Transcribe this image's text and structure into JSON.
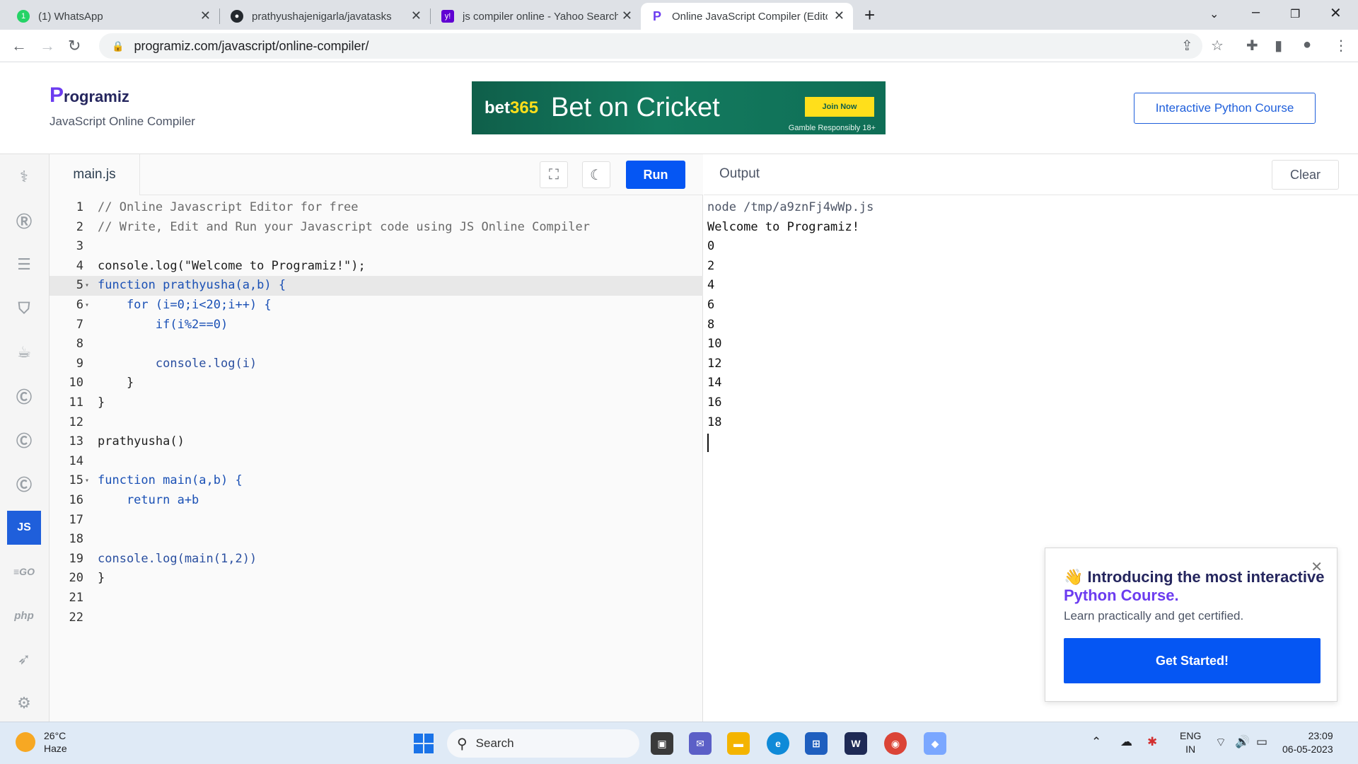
{
  "browser": {
    "tabs": [
      {
        "title": "(1) WhatsApp",
        "icon": "whatsapp-icon",
        "color": "#25d366"
      },
      {
        "title": "prathyushajenigarla/javatasks",
        "icon": "github-icon",
        "color": "#24292e"
      },
      {
        "title": "js compiler online - Yahoo Search",
        "icon": "yahoo-icon",
        "color": "#6001d2"
      },
      {
        "title": "Online JavaScript Compiler (Edito",
        "icon": "programiz-icon",
        "color": "#6c3cf0",
        "active": true
      }
    ],
    "new_tab": "+",
    "url": "programiz.com/javascript/online-compiler/"
  },
  "site": {
    "logo": "rogramiz",
    "logo_initial": "P",
    "subtitle": "JavaScript Online Compiler",
    "ad": {
      "brand_a": "bet",
      "brand_b": "365",
      "headline": "Bet on Cricket",
      "cta": "Join Now",
      "disclaimer": "Gamble Responsibly  18+"
    },
    "python_course_button": "Interactive Python Course"
  },
  "sidebar": {
    "languages": [
      {
        "name": "python-icon",
        "glyph": "Py"
      },
      {
        "name": "r-icon",
        "glyph": "R"
      },
      {
        "name": "sql-icon",
        "glyph": "DB"
      },
      {
        "name": "html-icon",
        "glyph": "5"
      },
      {
        "name": "java-icon",
        "glyph": "J"
      },
      {
        "name": "c-icon",
        "glyph": "C"
      },
      {
        "name": "cpp-icon",
        "glyph": "C+"
      },
      {
        "name": "csharp-icon",
        "glyph": "C#"
      },
      {
        "name": "js-icon",
        "glyph": "JS",
        "active": true
      },
      {
        "name": "go-icon",
        "glyph": "GO"
      },
      {
        "name": "php-icon",
        "glyph": "php"
      },
      {
        "name": "swift-icon",
        "glyph": "S"
      },
      {
        "name": "rust-icon",
        "glyph": "R"
      }
    ]
  },
  "editor": {
    "filename": "main.js",
    "run_label": "Run",
    "lines": [
      "// Online Javascript Editor for free",
      "// Write, Edit and Run your Javascript code using JS Online Compiler",
      "",
      "console.log(\"Welcome to Programiz!\");",
      "function prathyusha(a,b) {",
      "    for (i=0;i<20;i++) {",
      "        if(i%2==0)",
      "",
      "        console.log(i)",
      "    }",
      "}",
      "",
      "prathyusha()",
      "",
      "function main(a,b) {",
      "    return a+b",
      "",
      "",
      "console.log(main(1,2))",
      "}",
      "",
      ""
    ],
    "highlighted_line": 5,
    "fold_lines": [
      5,
      6,
      15
    ]
  },
  "output": {
    "title": "Output",
    "clear_label": "Clear",
    "lines": [
      "node /tmp/a9znFj4wWp.js",
      "Welcome to Programiz!",
      "0",
      "2",
      "4",
      "6",
      "8",
      "10",
      "12",
      "14",
      "16",
      "18"
    ]
  },
  "promo": {
    "emoji": "👋",
    "heading_a": "Introducing the most interactive ",
    "heading_b": "Python Course.",
    "subtext": "Learn practically and get certified.",
    "cta": "Get Started!"
  },
  "taskbar": {
    "temperature": "26°C",
    "condition": "Haze",
    "search_placeholder": "Search",
    "lang": "ENG",
    "region": "IN",
    "time": "23:09",
    "date": "06-05-2023"
  }
}
